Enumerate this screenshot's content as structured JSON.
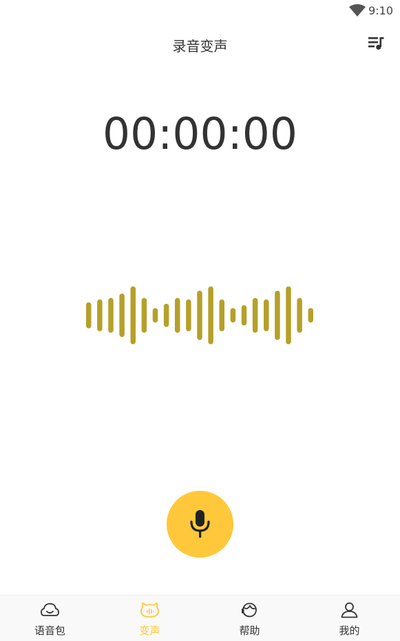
{
  "status_bar": {
    "time": "9:10",
    "wifi_icon": "wifi-icon"
  },
  "app_bar": {
    "title": "录音变声",
    "playlist_icon": "playlist-music-icon"
  },
  "timer": {
    "value": "00:00:00"
  },
  "waveform": {
    "color": "#b5a02a",
    "levels": [
      0.45,
      0.55,
      0.6,
      0.75,
      1.0,
      0.6,
      0.25,
      0.4,
      0.6,
      0.55,
      0.85,
      1.0,
      0.55,
      0.25,
      0.35,
      0.6,
      0.55,
      0.85,
      1.0,
      0.6,
      0.25
    ]
  },
  "record_button": {
    "icon": "microphone-icon",
    "color": "#ffc83a"
  },
  "bottom_nav": {
    "active_color": "#ffc83a",
    "items": [
      {
        "label": "语音包",
        "icon": "voice-pack-icon",
        "active": false
      },
      {
        "label": "变声",
        "icon": "voice-change-icon",
        "active": true
      },
      {
        "label": "帮助",
        "icon": "help-headset-icon",
        "active": false
      },
      {
        "label": "我的",
        "icon": "profile-icon",
        "active": false
      }
    ]
  }
}
